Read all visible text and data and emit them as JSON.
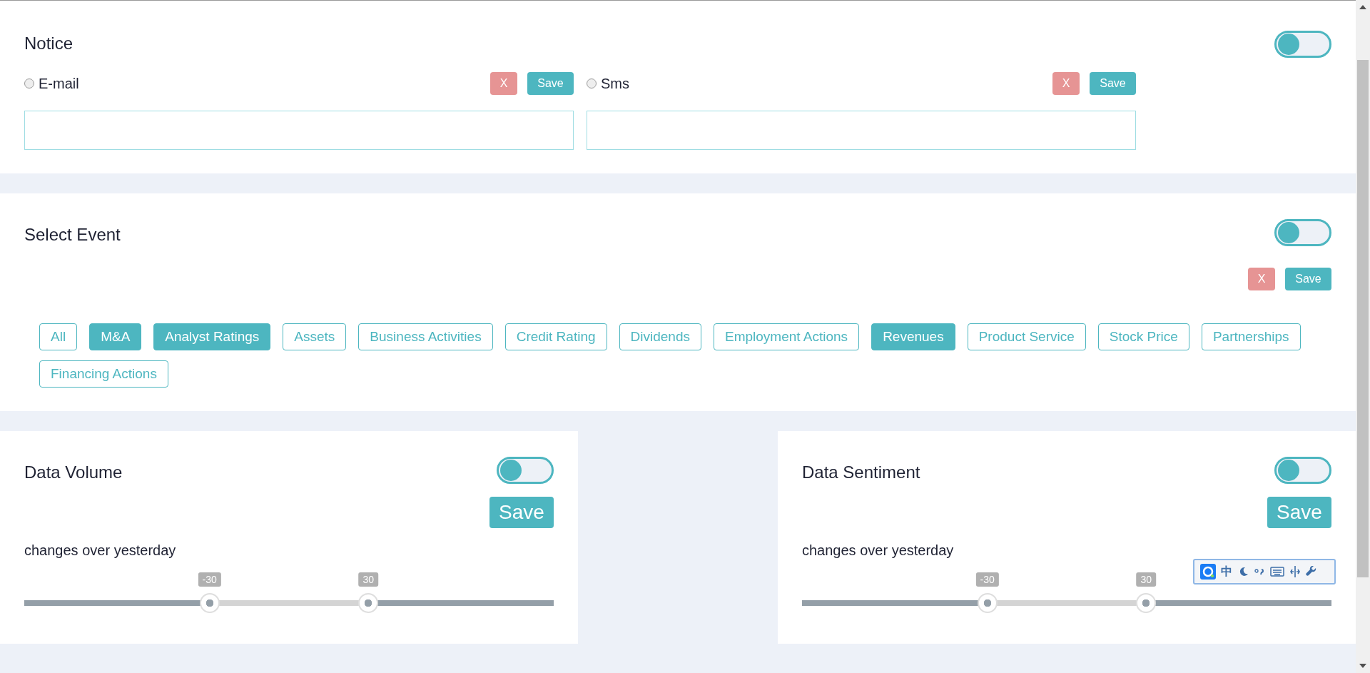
{
  "notice": {
    "title": "Notice",
    "toggle": {
      "on": false
    },
    "channels": [
      {
        "label": "E-mail",
        "checked": false,
        "clear": "X",
        "save": "Save"
      },
      {
        "label": "Sms",
        "checked": false,
        "clear": "X",
        "save": "Save"
      }
    ]
  },
  "select_event": {
    "title": "Select Event",
    "toggle": {
      "on": false
    },
    "clear": "X",
    "save": "Save",
    "tags": [
      {
        "label": "All",
        "selected": false
      },
      {
        "label": "M&A",
        "selected": true
      },
      {
        "label": "Analyst Ratings",
        "selected": true
      },
      {
        "label": "Assets",
        "selected": false
      },
      {
        "label": "Business Activities",
        "selected": false
      },
      {
        "label": "Credit Rating",
        "selected": false
      },
      {
        "label": "Dividends",
        "selected": false
      },
      {
        "label": "Employment Actions",
        "selected": false
      },
      {
        "label": "Revenues",
        "selected": true
      },
      {
        "label": "Product Service",
        "selected": false
      },
      {
        "label": "Stock Price",
        "selected": false
      },
      {
        "label": "Partnerships",
        "selected": false
      },
      {
        "label": "Financing Actions",
        "selected": false
      }
    ]
  },
  "cards": [
    {
      "title": "Data Volume",
      "toggle": {
        "on": false
      },
      "save": "Save",
      "caption": "changes over yesterday",
      "thumbs": [
        {
          "label": "-30",
          "level": 0.35
        },
        {
          "label": "30",
          "level": 0.65
        }
      ]
    },
    {
      "title": "Data Sentiment",
      "toggle": {
        "on": false
      },
      "save": "Save",
      "caption": "changes over yesterday",
      "thumbs": [
        {
          "label": "-30",
          "level": 0.35
        },
        {
          "label": "30",
          "level": 0.65
        }
      ]
    }
  ],
  "ime_toolbar": {
    "language": "中"
  }
}
